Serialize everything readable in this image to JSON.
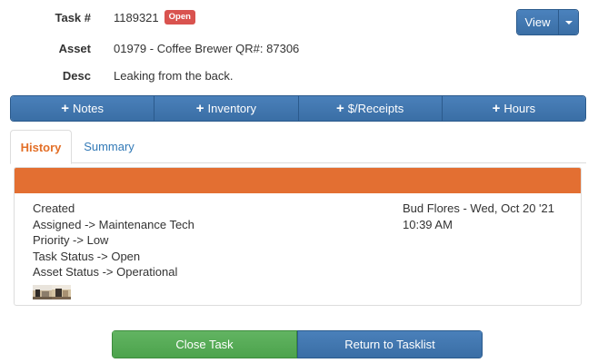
{
  "task": {
    "task_label": "Task #",
    "task_number": "1189321",
    "status_badge": "Open",
    "asset_label": "Asset",
    "asset_value": "01979 - Coffee Brewer QR#: 87306",
    "desc_label": "Desc",
    "desc_value": "Leaking from the back."
  },
  "view_button": {
    "label": "View"
  },
  "actions": [
    {
      "label": "Notes",
      "icon": "plus-icon"
    },
    {
      "label": "Inventory",
      "icon": "plus-icon"
    },
    {
      "label": "$/Receipts",
      "icon": "plus-icon"
    },
    {
      "label": "Hours",
      "icon": "plus-icon"
    }
  ],
  "tabs": [
    {
      "label": "History",
      "active": true
    },
    {
      "label": "Summary",
      "active": false
    }
  ],
  "history": {
    "header_color": "#e36f32",
    "lines": [
      "Created",
      "Assigned -> Maintenance Tech",
      "Priority -> Low",
      "Task Status -> Open",
      "Asset Status -> Operational"
    ],
    "author_date": "Bud Flores - Wed, Oct 20 '21",
    "time": "10:39 AM"
  },
  "bottom_buttons": {
    "close": "Close Task",
    "return": "Return to Tasklist"
  },
  "colors": {
    "primary": "#3a6ea5",
    "success": "#4ca34c",
    "danger": "#d9534f",
    "accent": "#e36f27"
  }
}
